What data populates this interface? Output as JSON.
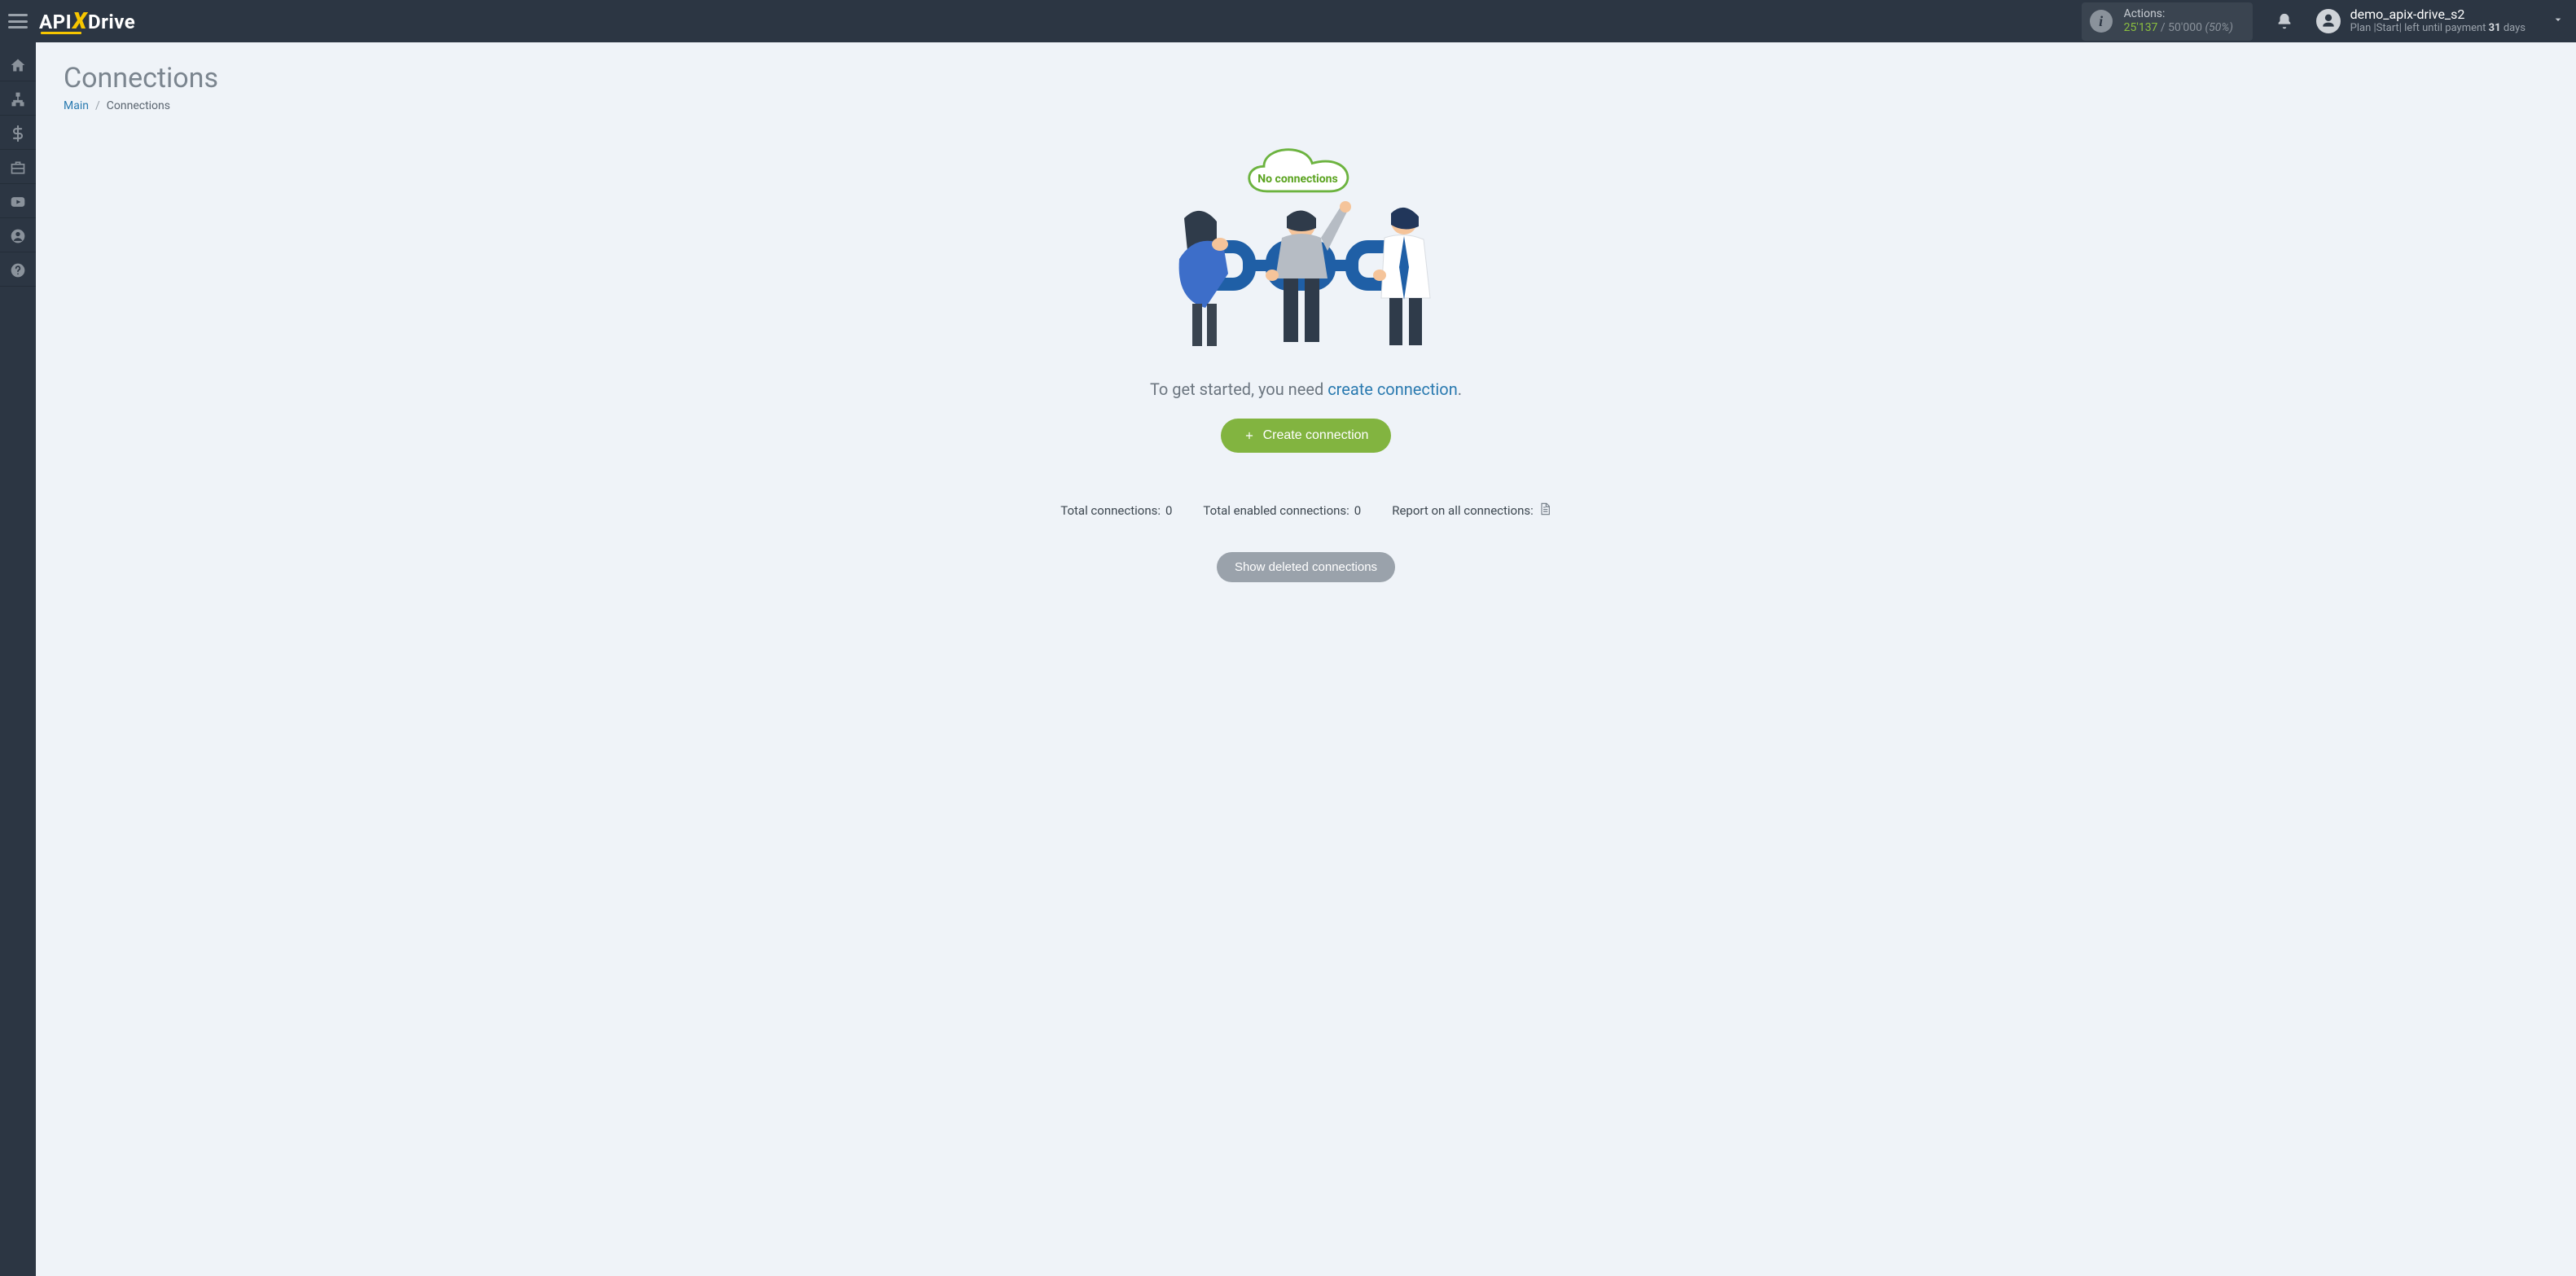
{
  "header": {
    "logo": {
      "part1": "API",
      "part2": "X",
      "part3": "Drive"
    },
    "actions": {
      "label": "Actions:",
      "used": "25'137",
      "separator": " / ",
      "limit": "50'000",
      "percent": "(50%)"
    },
    "user": {
      "name": "demo_apix-drive_s2",
      "plan_prefix": "Plan |",
      "plan_name": "Start",
      "plan_mid": "| left until payment ",
      "days": "31",
      "days_suffix": " days"
    }
  },
  "sidebar": {
    "items": [
      {
        "name": "home"
      },
      {
        "name": "connections"
      },
      {
        "name": "billing"
      },
      {
        "name": "toolbox"
      },
      {
        "name": "video"
      },
      {
        "name": "account"
      },
      {
        "name": "help"
      }
    ]
  },
  "page": {
    "title": "Connections",
    "breadcrumb": {
      "root": "Main",
      "separator": "/",
      "current": "Connections"
    },
    "empty": {
      "cloud_label": "No connections",
      "lead_prefix": "To get started, you need ",
      "lead_link": "create connection",
      "lead_suffix": ".",
      "create_button": "Create connection"
    },
    "stats": {
      "total_label": "Total connections: ",
      "total_value": "0",
      "enabled_label": "Total enabled connections: ",
      "enabled_value": "0",
      "report_label": "Report on all connections: "
    },
    "deleted_button": "Show deleted connections"
  }
}
